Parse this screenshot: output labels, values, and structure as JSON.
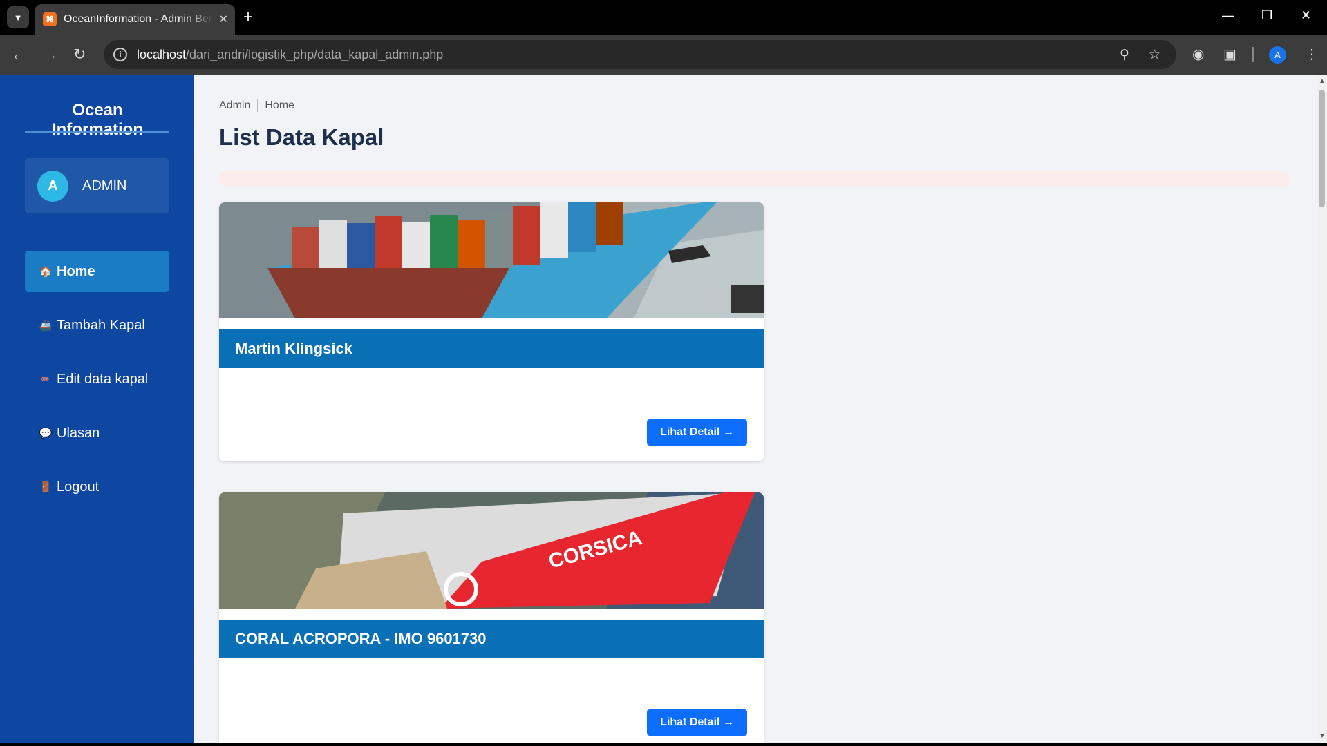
{
  "browser": {
    "tab_title": "OceanInformation - Admin Beranda",
    "tab_favicon_label": "⌘",
    "url_host": "localhost",
    "url_path": "/dari_andri/logistik_php/data_kapal_admin.php",
    "profile_initial": "A"
  },
  "sidebar": {
    "brand": "Ocean Information",
    "user": {
      "initial": "A",
      "name": "ADMIN"
    },
    "items": [
      {
        "label": "Home",
        "icon": "home-icon",
        "glyph": "🏠",
        "active": true
      },
      {
        "label": "Tambah Kapal",
        "icon": "ship-icon",
        "glyph": "🚢",
        "active": false
      },
      {
        "label": "Edit data kapal",
        "icon": "pencil-icon",
        "glyph": "✏",
        "active": false
      },
      {
        "label": "Ulasan",
        "icon": "speech-bubble-icon",
        "glyph": "💬",
        "active": false
      },
      {
        "label": "Logout",
        "icon": "door-icon",
        "glyph": "🚪",
        "active": false
      }
    ]
  },
  "main": {
    "breadcrumb": [
      "Admin",
      "Home"
    ],
    "title": "List Data Kapal",
    "cards": [
      {
        "name": "Martin Klingsick",
        "button": "Lihat Detail →"
      },
      {
        "name": "CORAL ACROPORA - IMO 9601730",
        "button": "Lihat Detail →"
      }
    ]
  },
  "colors": {
    "sidebar_bg": "#0d47a1",
    "menu_active": "#1a7cc4",
    "card_header": "#0a70b6",
    "button": "#0d6efd",
    "title": "#1d2f4d"
  }
}
